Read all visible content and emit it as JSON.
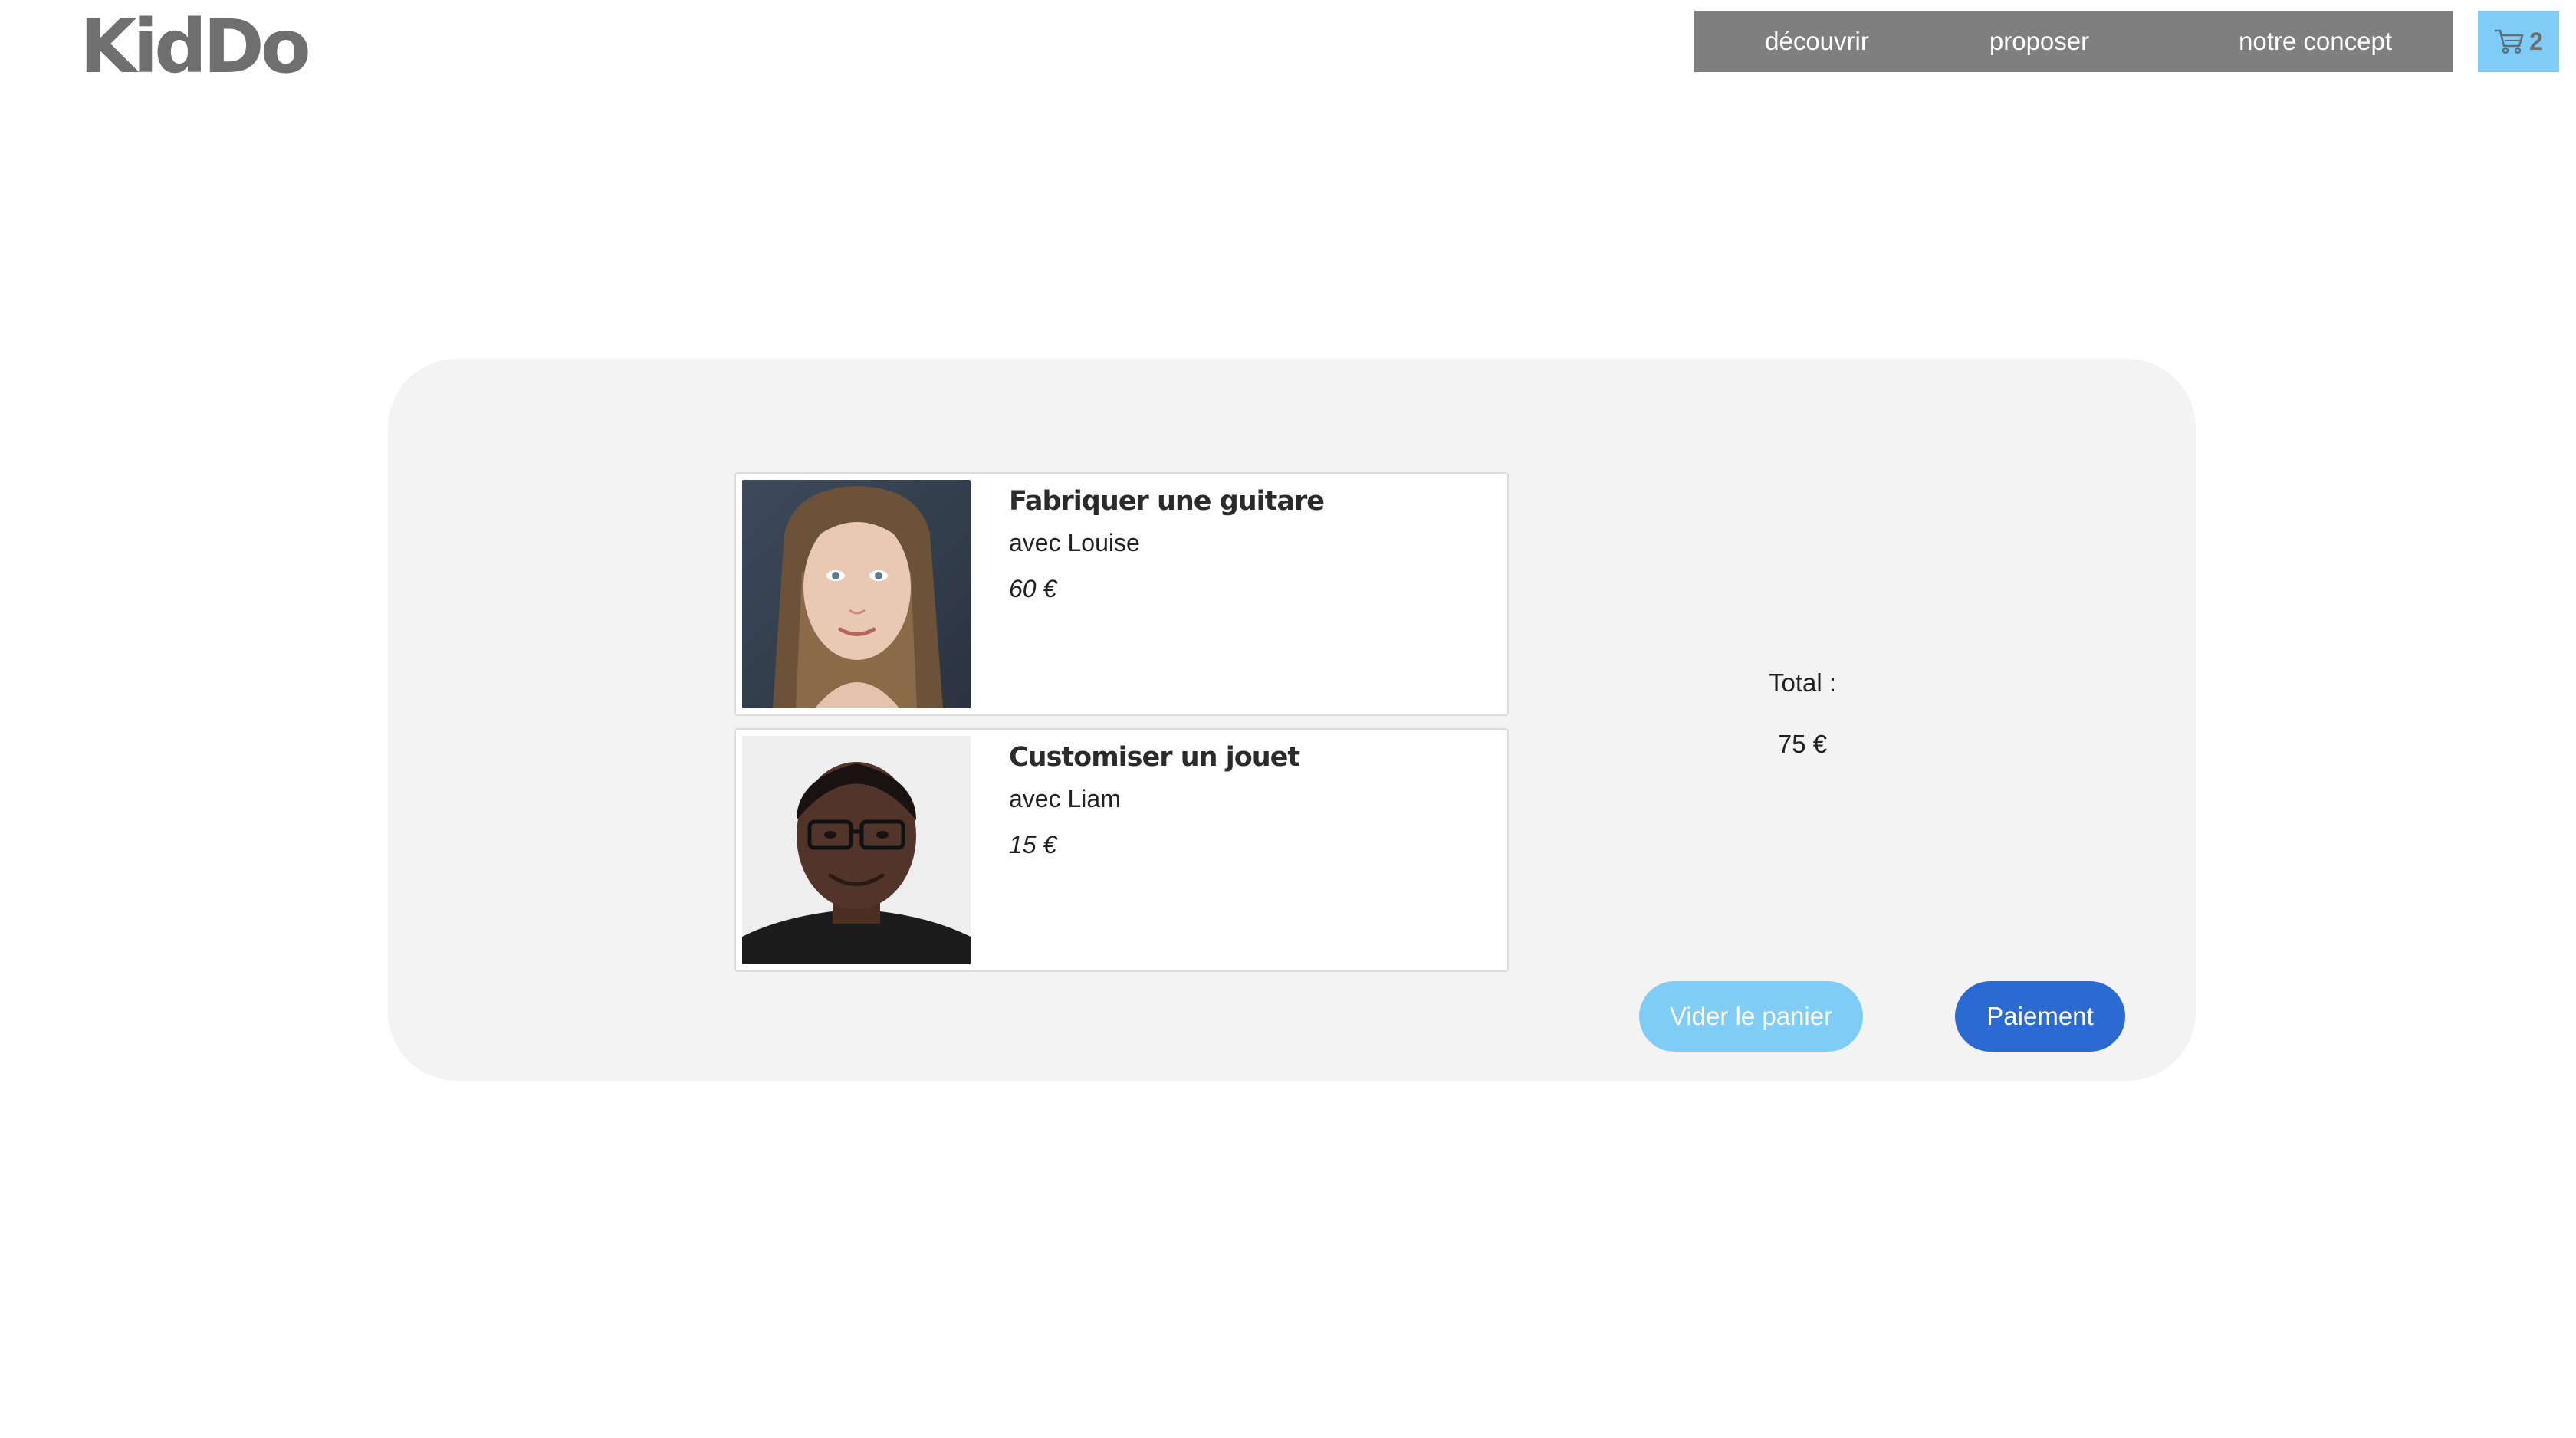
{
  "brand": {
    "logo_text": "KidDo"
  },
  "nav": {
    "items": [
      {
        "label": "découvrir"
      },
      {
        "label": "proposer"
      },
      {
        "label": "notre concept"
      }
    ]
  },
  "cart": {
    "icon": "cart-icon",
    "count": "2",
    "color": "#7fcdf6"
  },
  "basket": {
    "items": [
      {
        "title": "Fabriquer une guitare",
        "with": "avec Louise",
        "price": "60 €",
        "photo": "portrait-woman"
      },
      {
        "title": "Customiser un jouet",
        "with": "avec Liam",
        "price": "15 €",
        "photo": "portrait-man"
      }
    ],
    "total_label": "Total :",
    "total_value": "75 €",
    "empty_button": "Vider le panier",
    "pay_button": "Paiement"
  },
  "colors": {
    "nav_bg": "#7f7f7f",
    "panel_bg": "#f3f3f3",
    "empty_button": "#7fcdf6",
    "pay_button": "#2a6ad2"
  }
}
